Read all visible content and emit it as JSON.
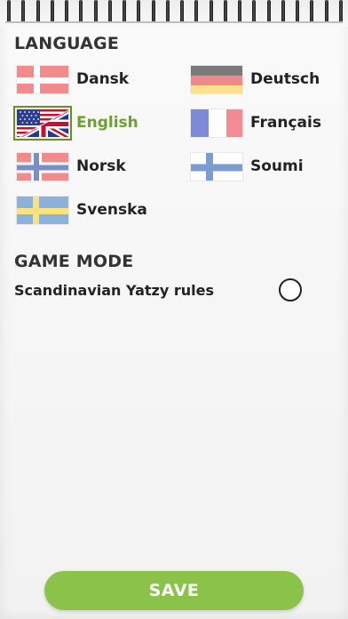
{
  "sections": {
    "language_title": "LANGUAGE",
    "game_mode_title": "GAME MODE"
  },
  "languages": [
    {
      "label": "Dansk",
      "flag": "denmark-flag-icon",
      "selected": false
    },
    {
      "label": "Deutsch",
      "flag": "germany-flag-icon",
      "selected": false
    },
    {
      "label": "English",
      "flag": "usa-uk-flag-icon",
      "selected": true
    },
    {
      "label": "Français",
      "flag": "france-flag-icon",
      "selected": false
    },
    {
      "label": "Norsk",
      "flag": "norway-flag-icon",
      "selected": false
    },
    {
      "label": "Soumi",
      "flag": "finland-flag-icon",
      "selected": false
    },
    {
      "label": "Svenska",
      "flag": "sweden-flag-icon",
      "selected": false
    }
  ],
  "game_mode": {
    "option_label": "Scandinavian Yatzy rules",
    "checked": false
  },
  "save_button": {
    "label": "SAVE"
  },
  "colors": {
    "accent_green": "#6aa329",
    "save_button": "#8bc34a",
    "text": "#222222"
  }
}
